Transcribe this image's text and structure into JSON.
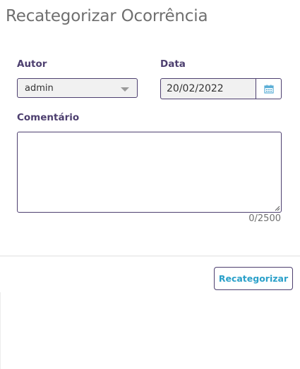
{
  "dialog": {
    "title": "Recategorizar Ocorrência"
  },
  "form": {
    "author": {
      "label": "Autor",
      "value": "admin"
    },
    "date": {
      "label": "Data",
      "value": "20/02/2022"
    },
    "comment": {
      "label": "Comentário",
      "value": "",
      "counter": "0/2500"
    }
  },
  "actions": {
    "submit_label": "Recategorizar"
  },
  "colors": {
    "accent_text": "#4d3f6f",
    "button_text": "#2aa0c9",
    "calendar_icon": "#5aaed6"
  },
  "icons": {
    "select_caret": "chevron-down-icon",
    "calendar": "calendar-icon",
    "resize": "resize-grip-icon"
  }
}
